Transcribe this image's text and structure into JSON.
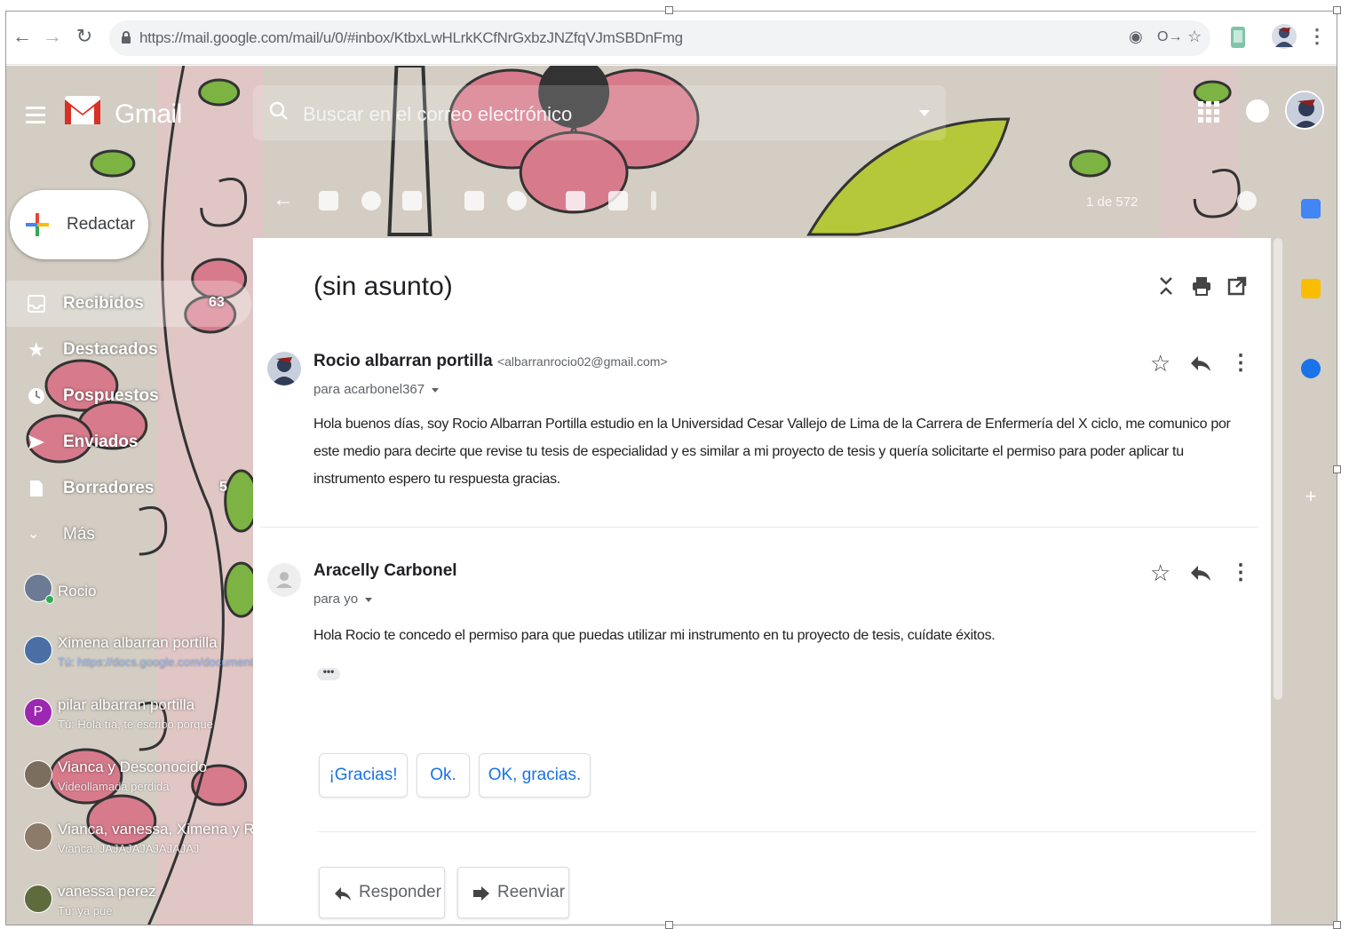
{
  "browser": {
    "url": "https://mail.google.com/mail/u/0/#inbox/KtbxLwHLrkKCfNrGxbzJNZfqVJmSBDnFmg"
  },
  "gmail": {
    "brand": "Gmail",
    "search_placeholder": "Buscar en el correo electrónico",
    "compose_label": "Redactar",
    "pager": "1 de 572"
  },
  "sidebar": {
    "items": [
      {
        "label": "Recibidos",
        "count": "63",
        "icon": "inbox-icon",
        "active": true
      },
      {
        "label": "Destacados",
        "count": "",
        "icon": "star-icon",
        "active": false
      },
      {
        "label": "Pospuestos",
        "count": "",
        "icon": "clock-icon",
        "active": false
      },
      {
        "label": "Enviados",
        "count": "",
        "icon": "send-icon",
        "active": false
      },
      {
        "label": "Borradores",
        "count": "5",
        "icon": "draft-icon",
        "active": false
      },
      {
        "label": "Más",
        "count": "",
        "icon": "chevron-down-icon",
        "active": false
      }
    ],
    "hangouts": [
      {
        "name": "Rocio",
        "sub": "",
        "color": "#6c7a94"
      },
      {
        "name": "Ximena albarran portilla",
        "sub": "Tú: https://docs.google.com/document",
        "color": "#4a6fa5"
      },
      {
        "name": "pilar albarran portilla",
        "sub": "Tú: Hola tía, te escribo porque",
        "color": "#9c27b0",
        "initial": "P"
      },
      {
        "name": "Vianca y Desconocido",
        "sub": "Videollamada perdida",
        "color": "#7b6e5f"
      },
      {
        "name": "Vianca, vanessa, Ximena y Ro",
        "sub": "Vianca: JAJAJAJAJAJAJAJ",
        "color": "#8d7b6a"
      },
      {
        "name": "vanessa perez",
        "sub": "Tú: ya pue",
        "color": "#5e6b3c"
      }
    ]
  },
  "thread": {
    "subject": "(sin asunto)",
    "messages": [
      {
        "sender": "Rocio albarran portilla",
        "email": "<albarranrocio02@gmail.com>",
        "to": "para acarbonel367",
        "body": "Hola buenos días, soy Rocio Albarran Portilla estudio en la Universidad Cesar Vallejo de Lima de la Carrera de Enfermería del X ciclo, me comunico  por este medio para decirte que revise  tu tesis de especialidad y es similar a mi proyecto de tesis y quería solicitarte el permiso para poder aplicar tu instrumento espero tu respuesta gracias."
      },
      {
        "sender": "Aracelly Carbonel",
        "email": "",
        "to": "para yo",
        "body": "Hola Rocio te concedo el permiso para que puedas utilizar mi instrumento en tu proyecto de tesis, cuídate éxitos.",
        "ellipsis": "•••"
      }
    ],
    "smart_replies": [
      "¡Gracias!",
      "Ok.",
      "OK, gracias."
    ],
    "reply_label": "Responder",
    "forward_label": "Reenviar"
  },
  "colors": {
    "accent_blue": "#1a73e8",
    "gmail_red": "#d93025",
    "theme_pink": "#d77b8c",
    "theme_green": "#7cb342"
  }
}
